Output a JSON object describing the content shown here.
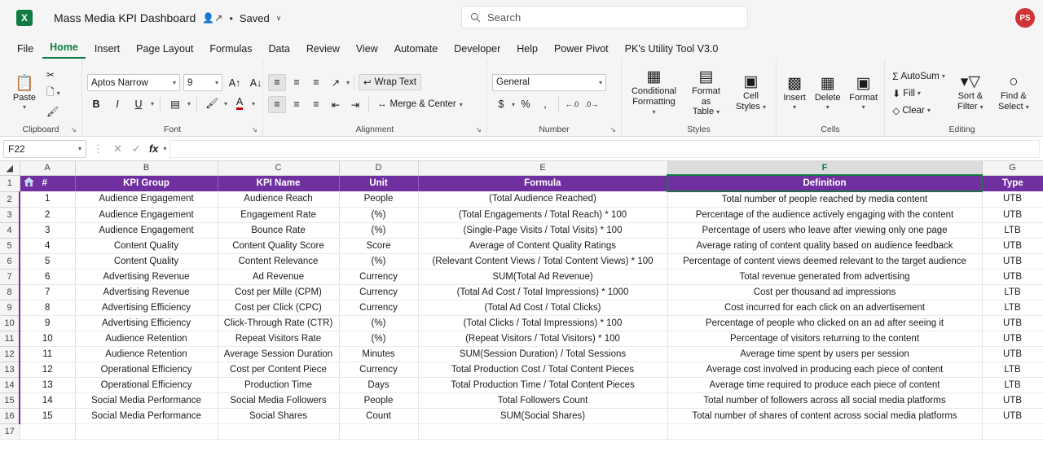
{
  "titlebar": {
    "app_icon": "excel-logo",
    "app_icon_letter": "X",
    "document_title": "Mass Media KPI Dashboard",
    "share_icon": "person-share-icon",
    "separator_dot": "•",
    "save_status": "Saved",
    "chevron": "∨"
  },
  "search": {
    "icon": "search-icon",
    "placeholder": "Search"
  },
  "account": {
    "initials": "PS",
    "color": "#d13438"
  },
  "ribbon_tabs": [
    {
      "label": "File",
      "active": false
    },
    {
      "label": "Home",
      "active": true
    },
    {
      "label": "Insert",
      "active": false
    },
    {
      "label": "Page Layout",
      "active": false
    },
    {
      "label": "Formulas",
      "active": false
    },
    {
      "label": "Data",
      "active": false
    },
    {
      "label": "Review",
      "active": false
    },
    {
      "label": "View",
      "active": false
    },
    {
      "label": "Automate",
      "active": false
    },
    {
      "label": "Developer",
      "active": false
    },
    {
      "label": "Help",
      "active": false
    },
    {
      "label": "Power Pivot",
      "active": false
    },
    {
      "label": "PK's Utility Tool V3.0",
      "active": false
    }
  ],
  "ribbon": {
    "clipboard": {
      "group_label": "Clipboard",
      "paste_label": "Paste",
      "paste_icon": "clipboard-icon",
      "cut_icon": "scissors-icon",
      "copy_icon": "copy-icon",
      "format_painter_icon": "paintbrush-icon",
      "dialog_launcher": "↘"
    },
    "font": {
      "group_label": "Font",
      "font_name": "Aptos Narrow",
      "font_size": "9",
      "grow_font_icon": "A-up-icon",
      "shrink_font_icon": "A-down-icon",
      "bold_label": "B",
      "italic_label": "I",
      "underline_label": "U",
      "borders_icon": "borders-icon",
      "fill_color_icon": "fill-color-icon",
      "font_color_icon": "font-color-icon",
      "dialog_launcher": "↘"
    },
    "alignment": {
      "group_label": "Alignment",
      "align_top_icon": "align-top-icon",
      "align_middle_icon": "align-middle-icon",
      "align_bottom_icon": "align-bottom-icon",
      "orientation_icon": "text-orientation-icon",
      "wrap_text_label": "Wrap Text",
      "wrap_text_icon": "wrap-text-icon",
      "align_left_icon": "align-left-icon",
      "align_center_icon": "align-center-icon",
      "align_right_icon": "align-right-icon",
      "decrease_indent_icon": "decrease-indent-icon",
      "increase_indent_icon": "increase-indent-icon",
      "merge_center_label": "Merge & Center",
      "merge_center_icon": "merge-cells-icon",
      "dialog_launcher": "↘"
    },
    "number": {
      "group_label": "Number",
      "format": "General",
      "currency_icon": "dollar-icon",
      "percent_icon": "percent-icon",
      "comma_icon": "comma-icon",
      "increase_decimal_icon": "increase-decimal-icon",
      "decrease_decimal_icon": "decrease-decimal-icon",
      "dialog_launcher": "↘"
    },
    "styles": {
      "group_label": "Styles",
      "conditional_formatting_label": "Conditional\nFormatting",
      "conditional_formatting_line1": "Conditional",
      "conditional_formatting_line2": "Formatting",
      "format_as_table_line1": "Format as",
      "format_as_table_line2": "Table",
      "cell_styles_line1": "Cell",
      "cell_styles_line2": "Styles",
      "conditional_formatting_icon": "conditional-formatting-icon",
      "format_as_table_icon": "format-as-table-icon",
      "cell_styles_icon": "cell-styles-icon"
    },
    "cells": {
      "group_label": "Cells",
      "insert_label": "Insert",
      "delete_label": "Delete",
      "format_label": "Format",
      "insert_icon": "insert-cells-icon",
      "delete_icon": "delete-cells-icon",
      "format_icon": "format-cells-icon"
    },
    "editing": {
      "group_label": "Editing",
      "autosum_label": "AutoSum",
      "autosum_icon": "sigma-icon",
      "fill_label": "Fill",
      "fill_icon": "fill-down-icon",
      "clear_label": "Clear",
      "clear_icon": "eraser-icon",
      "sort_filter_line1": "Sort &",
      "sort_filter_line2": "Filter",
      "sort_filter_icon": "sort-filter-icon",
      "find_select_line1": "Find &",
      "find_select_line2": "Select",
      "find_select_icon": "magnifier-icon"
    }
  },
  "formula_bar": {
    "name_box": "F22",
    "name_box_chevron": "∨",
    "more_icon": "more-options-icon",
    "cancel_icon": "✕",
    "enter_icon": "✓",
    "fx_label": "fx",
    "fx_chevron": "∨",
    "formula_value": ""
  },
  "grid": {
    "columns": [
      {
        "letter": "A",
        "selected": false
      },
      {
        "letter": "B",
        "selected": false
      },
      {
        "letter": "C",
        "selected": false
      },
      {
        "letter": "D",
        "selected": false
      },
      {
        "letter": "E",
        "selected": false
      },
      {
        "letter": "F",
        "selected": true
      },
      {
        "letter": "G",
        "selected": false
      }
    ],
    "header_row_number": "1",
    "header_home_icon": "home-icon",
    "headers": [
      "#",
      "KPI Group",
      "KPI Name",
      "Unit",
      "Formula",
      "Definition",
      "Type"
    ],
    "header_fill": "#7030a0",
    "rows": [
      {
        "n": "2",
        "cells": [
          "1",
          "Audience Engagement",
          "Audience Reach",
          "People",
          "(Total Audience Reached)",
          "Total number of people reached by media content",
          "UTB"
        ]
      },
      {
        "n": "3",
        "cells": [
          "2",
          "Audience Engagement",
          "Engagement Rate",
          "(%)",
          "(Total Engagements / Total Reach) * 100",
          "Percentage of the audience actively engaging with the content",
          "UTB"
        ]
      },
      {
        "n": "4",
        "cells": [
          "3",
          "Audience Engagement",
          "Bounce Rate",
          "(%)",
          "(Single-Page Visits / Total Visits) * 100",
          "Percentage of users who leave after viewing only one page",
          "LTB"
        ]
      },
      {
        "n": "5",
        "cells": [
          "4",
          "Content Quality",
          "Content Quality Score",
          "Score",
          "Average of Content Quality Ratings",
          "Average rating of content quality based on audience feedback",
          "UTB"
        ]
      },
      {
        "n": "6",
        "cells": [
          "5",
          "Content Quality",
          "Content Relevance",
          "(%)",
          "(Relevant Content Views / Total Content Views) * 100",
          "Percentage of content views deemed relevant to the target audience",
          "UTB"
        ]
      },
      {
        "n": "7",
        "cells": [
          "6",
          "Advertising Revenue",
          "Ad Revenue",
          "Currency",
          "SUM(Total Ad Revenue)",
          "Total revenue generated from advertising",
          "UTB"
        ]
      },
      {
        "n": "8",
        "cells": [
          "7",
          "Advertising Revenue",
          "Cost per Mille (CPM)",
          "Currency",
          "(Total Ad Cost / Total Impressions) * 1000",
          "Cost per thousand ad impressions",
          "LTB"
        ]
      },
      {
        "n": "9",
        "cells": [
          "8",
          "Advertising Efficiency",
          "Cost per Click (CPC)",
          "Currency",
          "(Total Ad Cost / Total Clicks)",
          "Cost incurred for each click on an advertisement",
          "LTB"
        ]
      },
      {
        "n": "10",
        "cells": [
          "9",
          "Advertising Efficiency",
          "Click-Through Rate (CTR)",
          "(%)",
          "(Total Clicks / Total Impressions) * 100",
          "Percentage of people who clicked on an ad after seeing it",
          "UTB"
        ]
      },
      {
        "n": "11",
        "cells": [
          "10",
          "Audience Retention",
          "Repeat Visitors Rate",
          "(%)",
          "(Repeat Visitors / Total Visitors) * 100",
          "Percentage of visitors returning to the content",
          "UTB"
        ]
      },
      {
        "n": "12",
        "cells": [
          "11",
          "Audience Retention",
          "Average Session Duration",
          "Minutes",
          "SUM(Session Duration) / Total Sessions",
          "Average time spent by users per session",
          "UTB"
        ]
      },
      {
        "n": "13",
        "cells": [
          "12",
          "Operational Efficiency",
          "Cost per Content Piece",
          "Currency",
          "Total Production Cost / Total Content Pieces",
          "Average cost involved in producing each piece of content",
          "LTB"
        ]
      },
      {
        "n": "14",
        "cells": [
          "13",
          "Operational Efficiency",
          "Production Time",
          "Days",
          "Total Production Time / Total Content Pieces",
          "Average time required to produce each piece of content",
          "LTB"
        ]
      },
      {
        "n": "15",
        "cells": [
          "14",
          "Social Media Performance",
          "Social Media Followers",
          "People",
          "Total Followers Count",
          "Total number of followers across all social media platforms",
          "UTB"
        ]
      },
      {
        "n": "16",
        "cells": [
          "15",
          "Social Media Performance",
          "Social Shares",
          "Count",
          "SUM(Social Shares)",
          "Total number of shares of content across social media platforms",
          "UTB"
        ]
      }
    ],
    "empty_rows": [
      "17"
    ]
  }
}
